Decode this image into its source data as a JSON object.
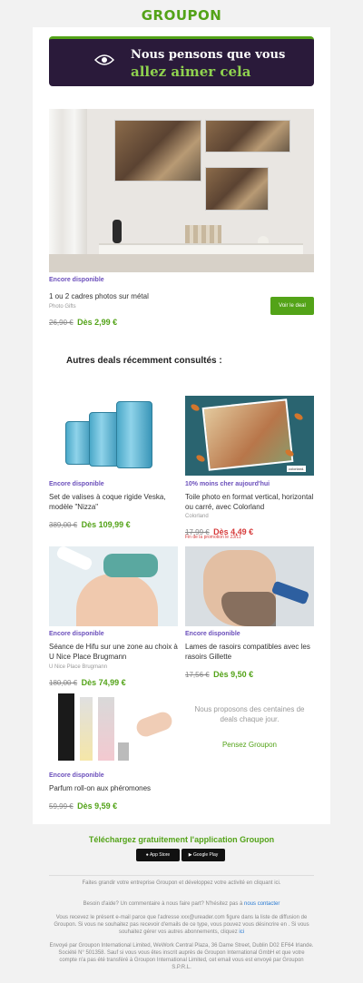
{
  "brand": {
    "logo": "GROUPON"
  },
  "hero": {
    "line1": "Nous pensons que vous",
    "line2": "allez aimer cela"
  },
  "featured": {
    "status": "Encore disponible",
    "title": "1 ou 2 cadres photos sur métal",
    "merchant": "Photo Gifts",
    "old_price": "26,90 €",
    "new_price": "Dès 2,99 €",
    "button": "Voir le deal"
  },
  "recent": {
    "heading": "Autres deals récemment consultés :",
    "deals": [
      {
        "status": "Encore disponible",
        "title": "Set de valises à coque rigide Veska, modèle \"Nizza\"",
        "merchant": "",
        "old_price": "389,00 €",
        "new_price": "Dès 109,99 €"
      },
      {
        "status": "10% moins cher aujourd'hui",
        "title": "Toile photo en format vertical, horizontal ou carré, avec Colorland",
        "merchant": "Colorland",
        "old_price": "17,99 €",
        "new_price": "Dès 4,49 €",
        "promo": "Fin de la promotion le 23/11",
        "image_tag": "colorland."
      },
      {
        "status": "Encore disponible",
        "title": "Séance de Hifu sur une zone au choix à U Nice Place Brugmann",
        "merchant": "U Nice Place Brugmann",
        "old_price": "180,00 €",
        "new_price": "Dès 74,99 €"
      },
      {
        "status": "Encore disponible",
        "title": "Lames de rasoirs compatibles avec les rasoirs Gillette",
        "merchant": "",
        "old_price": "17,56 €",
        "new_price": "Dès 9,50 €"
      },
      {
        "status": "Encore disponible",
        "title": "Parfum roll-on aux phéromones",
        "merchant": "",
        "old_price": "59,99 €",
        "new_price": "Dès 9,59 €"
      }
    ],
    "side_text": "Nous proposons des centaines de deals chaque jour.",
    "side_link": "Pensez Groupon"
  },
  "app": {
    "title": "Téléchargez gratuitement l'application Groupon",
    "app_store": "App Store",
    "google_play": "Google Play"
  },
  "footer": {
    "line1": "Faites grandir votre entreprise Groupon et développez votre activité en cliquant ici.",
    "help": "Besoin d'aide? Un commentaire à nous faire part? N'hésitez pas à",
    "help_link": "nous contacter",
    "legal1": "Vous recevez le présent e-mail parce que l'adresse xxx@ureader.com figure dans la liste de diffusion de Groupon. Si vous ne souhaitez pas recevoir d'emails de ce type, vous pouvez vous désincrire en . Si vous souhaitez gérer vos autres abonnements, cliquez",
    "legal1_link": "ici",
    "legal2": "Envoyé par Groupon International Limited, WeWork Central Plaza, 36 Dame Street, Dublin D02 EF64 Irlande. Société N° 501358. Sauf si vous vous êtes inscrit auprès de Groupon International GmbH et que votre compte n'a pas été transféré à Groupon International Limited, cet email vous est envoyé par Groupon S.P.R.L."
  },
  "colors": {
    "brand_green": "#53a318",
    "accent_purple": "#6b4fbb",
    "promo_red": "#d63a3a",
    "hero_bg": "#2a1a3a"
  }
}
